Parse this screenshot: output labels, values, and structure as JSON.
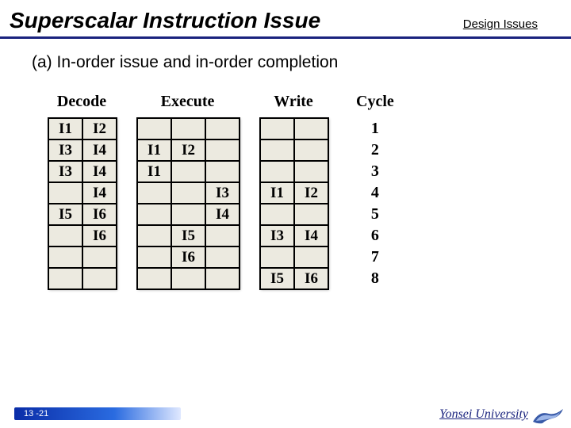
{
  "header": {
    "title": "Superscalar Instruction Issue",
    "section": "Design Issues"
  },
  "subtitle": "(a) In-order issue and in-order completion",
  "stages": [
    "Decode",
    "Execute",
    "Write",
    "Cycle"
  ],
  "chart_data": {
    "type": "table",
    "title": "Pipeline stage occupancy per cycle",
    "columns": [
      "Decode1",
      "Decode2",
      "Execute1",
      "Execute2",
      "Execute3",
      "Write1",
      "Write2",
      "Cycle"
    ],
    "rows": [
      [
        "I1",
        "I2",
        "",
        "",
        "",
        "",
        "",
        1
      ],
      [
        "I3",
        "I4",
        "I1",
        "I2",
        "",
        "",
        "",
        2
      ],
      [
        "I3",
        "I4",
        "I1",
        "",
        "",
        "",
        "",
        3
      ],
      [
        "",
        "I4",
        "",
        "",
        "I3",
        "I1",
        "I2",
        4
      ],
      [
        "I5",
        "I6",
        "",
        "",
        "I4",
        "",
        "",
        5
      ],
      [
        "",
        "I6",
        "",
        "I5",
        "",
        "I3",
        "I4",
        6
      ],
      [
        "",
        "",
        "",
        "I6",
        "",
        "",
        "",
        7
      ],
      [
        "",
        "",
        "",
        "",
        "",
        "I5",
        "I6",
        8
      ]
    ]
  },
  "table": {
    "decode": [
      [
        "I1",
        "I2"
      ],
      [
        "I3",
        "I4"
      ],
      [
        "I3",
        "I4"
      ],
      [
        "",
        "I4"
      ],
      [
        "I5",
        "I6"
      ],
      [
        "",
        "I6"
      ],
      [
        "",
        ""
      ],
      [
        "",
        ""
      ]
    ],
    "execute": [
      [
        "",
        "",
        ""
      ],
      [
        "I1",
        "I2",
        ""
      ],
      [
        "I1",
        "",
        ""
      ],
      [
        "",
        "",
        "I3"
      ],
      [
        "",
        "",
        "I4"
      ],
      [
        "",
        "I5",
        ""
      ],
      [
        "",
        "I6",
        ""
      ],
      [
        "",
        "",
        ""
      ]
    ],
    "write": [
      [
        "",
        ""
      ],
      [
        "",
        ""
      ],
      [
        "",
        ""
      ],
      [
        "I1",
        "I2"
      ],
      [
        "",
        ""
      ],
      [
        "I3",
        "I4"
      ],
      [
        "",
        ""
      ],
      [
        "I5",
        "I6"
      ]
    ],
    "cycle": [
      "1",
      "2",
      "3",
      "4",
      "5",
      "6",
      "7",
      "8"
    ]
  },
  "footer": {
    "page": "13 -21",
    "university": "Yonsei University"
  }
}
